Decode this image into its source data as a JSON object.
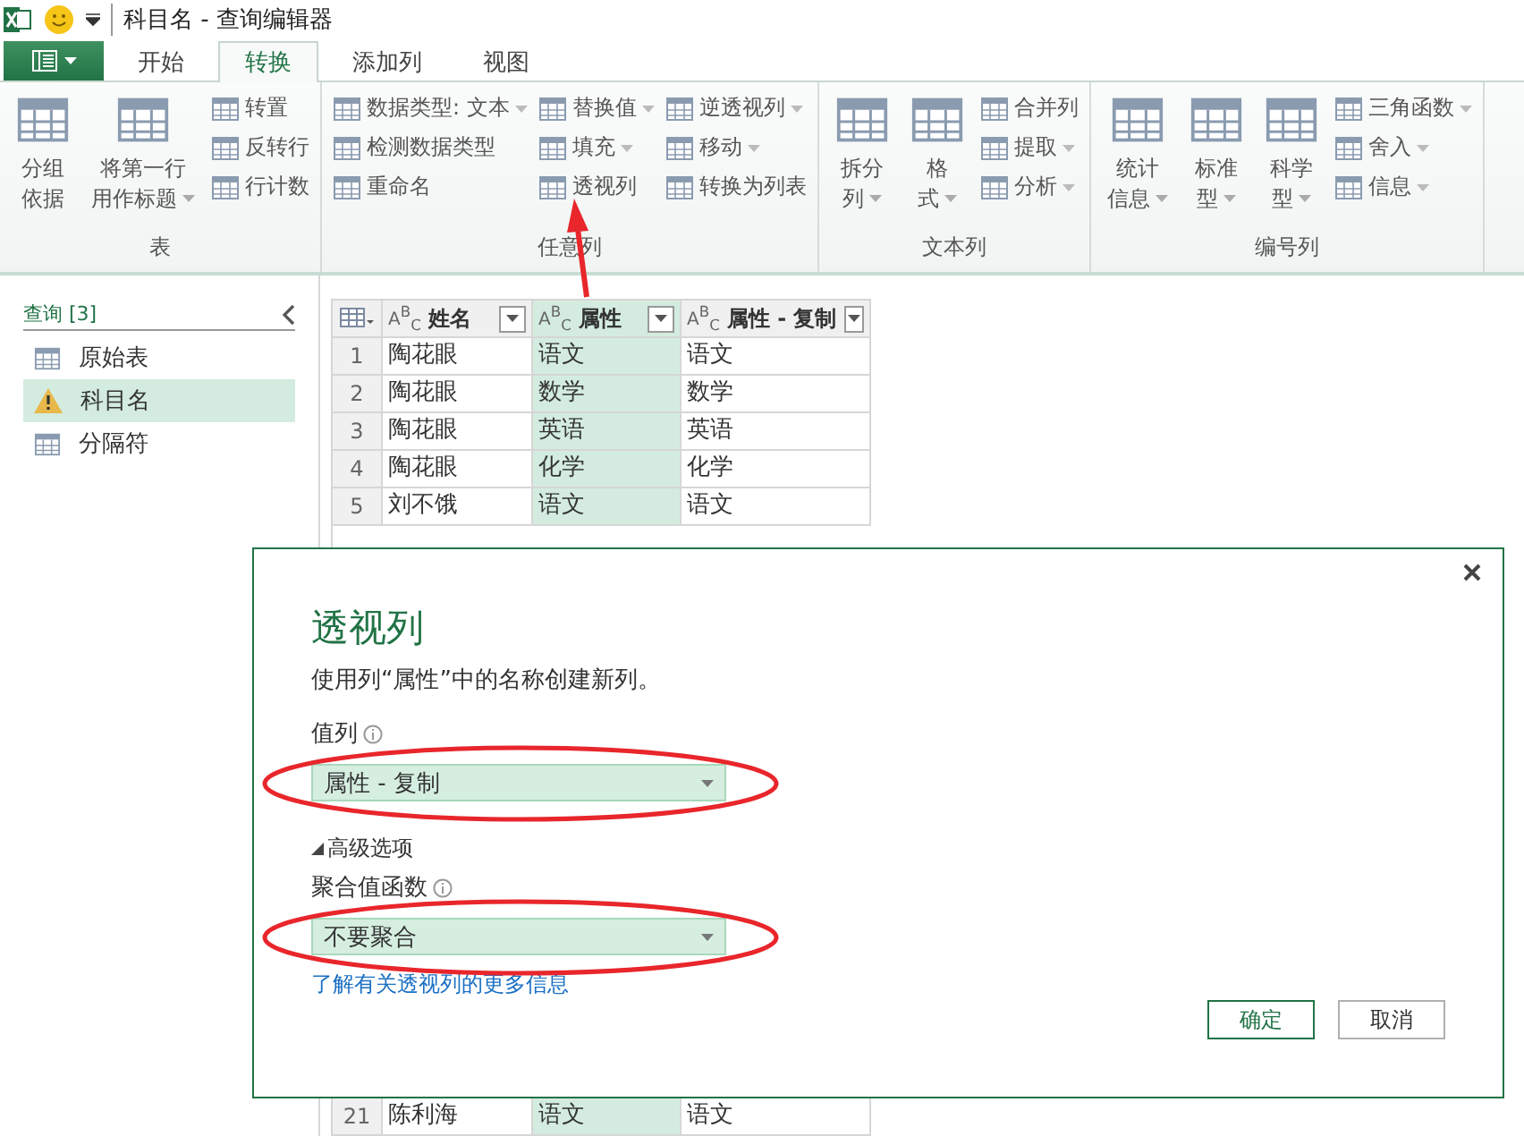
{
  "window": {
    "title": "科目名 - 查询编辑器"
  },
  "tabs": [
    {
      "label": "开始",
      "selected": false
    },
    {
      "label": "转换",
      "selected": true
    },
    {
      "label": "添加列",
      "selected": false
    },
    {
      "label": "视图",
      "selected": false
    }
  ],
  "ribbon": [
    {
      "label": "表",
      "columns": [
        {
          "kind": "large",
          "lines": [
            "分组",
            "依据"
          ],
          "dropdown": false
        },
        {
          "kind": "large",
          "lines": [
            "将第一行",
            "用作标题"
          ],
          "dropdown": true
        },
        {
          "kind": "stack",
          "items": [
            {
              "label": "转置",
              "dropdown": false
            },
            {
              "label": "反转行",
              "dropdown": false
            },
            {
              "label": "行计数",
              "dropdown": false
            }
          ]
        }
      ]
    },
    {
      "label": "任意列",
      "columns": [
        {
          "kind": "stack",
          "items": [
            {
              "label": "数据类型: 文本",
              "dropdown": true
            },
            {
              "label": "检测数据类型",
              "dropdown": false
            },
            {
              "label": "重命名",
              "dropdown": false
            }
          ]
        },
        {
          "kind": "stack",
          "items": [
            {
              "label": "替换值",
              "dropdown": true
            },
            {
              "label": "填充",
              "dropdown": true
            },
            {
              "label": "透视列",
              "dropdown": false
            }
          ]
        },
        {
          "kind": "stack",
          "items": [
            {
              "label": "逆透视列",
              "dropdown": true
            },
            {
              "label": "移动",
              "dropdown": true
            },
            {
              "label": "转换为列表",
              "dropdown": false
            }
          ]
        }
      ]
    },
    {
      "label": "文本列",
      "columns": [
        {
          "kind": "large",
          "lines": [
            "拆分",
            "列"
          ],
          "dropdown": true
        },
        {
          "kind": "large",
          "lines": [
            "格",
            "式"
          ],
          "dropdown": true
        },
        {
          "kind": "stack",
          "items": [
            {
              "label": "合并列",
              "dropdown": false
            },
            {
              "label": "提取",
              "dropdown": true
            },
            {
              "label": "分析",
              "dropdown": true
            }
          ]
        }
      ]
    },
    {
      "label": "编号列",
      "columns": [
        {
          "kind": "large",
          "lines": [
            "统计",
            "信息"
          ],
          "dropdown": true
        },
        {
          "kind": "large",
          "lines": [
            "标准",
            "型"
          ],
          "dropdown": true
        },
        {
          "kind": "large",
          "lines": [
            "科学",
            "型"
          ],
          "dropdown": true
        },
        {
          "kind": "stack",
          "items": [
            {
              "label": "三角函数",
              "dropdown": true
            },
            {
              "label": "舍入",
              "dropdown": true
            },
            {
              "label": "信息",
              "dropdown": true
            }
          ]
        }
      ]
    }
  ],
  "queries": {
    "header": "查询 [3]",
    "items": [
      {
        "label": "原始表",
        "kind": "table",
        "selected": false
      },
      {
        "label": "科目名",
        "kind": "warning",
        "selected": true
      },
      {
        "label": "分隔符",
        "kind": "table",
        "selected": false
      }
    ]
  },
  "table": {
    "columns": [
      {
        "type": "A$^{B}$$_{C}$",
        "name": "姓名",
        "selected": false
      },
      {
        "type": "A$^{B}$$_{C}$",
        "name": "属性",
        "selected": true
      },
      {
        "type": "A$^{B}$$_{C}$",
        "name": "属性 - 复制",
        "selected": false
      }
    ],
    "rows": [
      {
        "index": "1",
        "cells": [
          "陶花眼",
          "语文",
          "语文"
        ]
      },
      {
        "index": "2",
        "cells": [
          "陶花眼",
          "数学",
          "数学"
        ]
      },
      {
        "index": "3",
        "cells": [
          "陶花眼",
          "英语",
          "英语"
        ]
      },
      {
        "index": "4",
        "cells": [
          "陶花眼",
          "化学",
          "化学"
        ]
      },
      {
        "index": "5",
        "cells": [
          "刘不饿",
          "语文",
          "语文"
        ]
      }
    ],
    "rows_below": [
      {
        "index": "21",
        "cells": [
          "陈利海",
          "语文",
          "语文"
        ]
      }
    ]
  },
  "dialog": {
    "title": "透视列",
    "description": "使用列“属性”中的名称创建新列。",
    "value_label": "值列",
    "value_column": "属性 - 复制",
    "advanced": {
      "label": "高级选项",
      "expanded": true
    },
    "aggregate_label": "聚合值函数",
    "aggregate": "不要聚合",
    "link": "了解有关透视列的更多信息",
    "buttons": [
      {
        "label": "确定",
        "primary": true
      },
      {
        "label": "取消",
        "primary": false
      }
    ]
  }
}
